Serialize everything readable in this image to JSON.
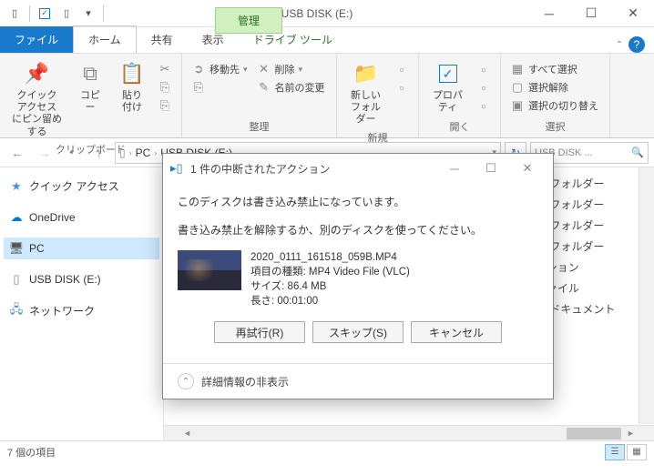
{
  "window": {
    "ctx_tab": "管理",
    "title": "USB DISK (E:)"
  },
  "tabs": {
    "file": "ファイル",
    "home": "ホーム",
    "share": "共有",
    "view": "表示",
    "drive_tools": "ドライブ ツール"
  },
  "ribbon": {
    "clipboard": {
      "pin": "クイック アクセス\nにピン留めする",
      "copy": "コピー",
      "paste": "貼り付け",
      "label": "クリップボード"
    },
    "organize": {
      "move_to": "移動先",
      "delete": "削除",
      "rename": "名前の変更",
      "label": "整理"
    },
    "new": {
      "new_folder": "新しい\nフォルダー",
      "label": "新規"
    },
    "open": {
      "properties": "プロパティ",
      "label": "開く"
    },
    "select": {
      "select_all": "すべて選択",
      "select_none": "選択解除",
      "invert": "選択の切り替え",
      "label": "選択"
    }
  },
  "address": {
    "pc": "PC",
    "drive": "USB DISK (E:)",
    "search_placeholder": "USB DISK ..."
  },
  "nav": {
    "quick_access": "クイック アクセス",
    "onedrive": "OneDrive",
    "pc": "PC",
    "usb": "USB DISK (E:)",
    "network": "ネットワーク"
  },
  "list": {
    "rows": [
      {
        "type": "ル フォルダー"
      },
      {
        "type": "ル フォルダー"
      },
      {
        "type": "ル フォルダー"
      },
      {
        "type": "ル フォルダー"
      },
      {
        "type": "ーション"
      },
      {
        "type": "ファイル"
      },
      {
        "type": "ト ドキュメント"
      }
    ]
  },
  "status": {
    "items": "7 個の項目"
  },
  "dialog": {
    "title": "1 件の中断されたアクション",
    "msg1": "このディスクは書き込み禁止になっています。",
    "msg2": "書き込み禁止を解除するか、別のディスクを使ってください。",
    "file": {
      "name": "2020_0111_161518_059B.MP4",
      "type": "項目の種類: MP4 Video File (VLC)",
      "size": "サイズ: 86.4 MB",
      "length": "長さ: 00:01:00"
    },
    "btn_retry": "再試行(R)",
    "btn_skip": "スキップ(S)",
    "btn_cancel": "キャンセル",
    "footer": "詳細情報の非表示"
  }
}
